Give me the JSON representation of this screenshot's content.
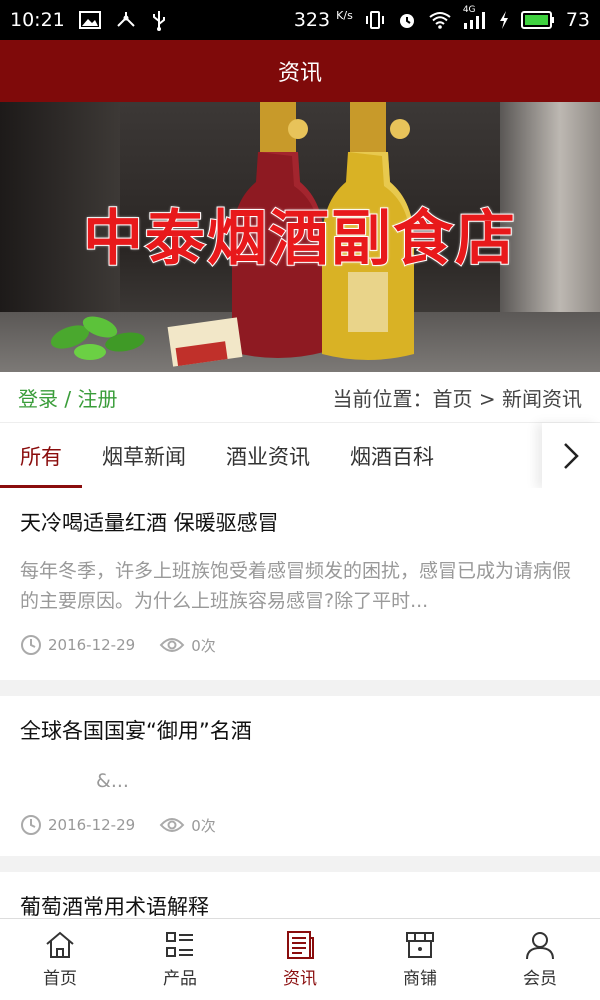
{
  "status_bar": {
    "time": "10:21",
    "speed_value": "323",
    "speed_unit": "K/s",
    "network": "4G",
    "battery": "73",
    "icons": [
      "image-icon",
      "usb-tether-icon",
      "usb-icon",
      "vibrate-icon",
      "alarm-icon",
      "wifi-icon",
      "signal-icon",
      "charging-icon",
      "battery-icon"
    ]
  },
  "appbar": {
    "title": "资讯"
  },
  "banner": {
    "text": "中泰烟酒副食店"
  },
  "locbar": {
    "login": "登录",
    "separator": "/",
    "register": "注册",
    "location_label": "当前位置：",
    "home": "首页",
    "arrow": ">",
    "current": "新闻资讯"
  },
  "tabs": [
    "所有",
    "烟草新闻",
    "酒业资讯",
    "烟酒百科"
  ],
  "news": [
    {
      "title": "天冷喝适量红酒 保暖驱感冒",
      "summary": "每年冬季，许多上班族饱受着感冒频发的困扰，感冒已成为请病假的主要原因。为什么上班族容易感冒?除了平时...",
      "date": "2016-12-29",
      "views": "0次"
    },
    {
      "title": "全球各国国宴“御用”名酒",
      "summary": "&...",
      "date": "2016-12-29",
      "views": "0次"
    },
    {
      "title": "葡萄酒常用术语解释",
      "summary": "",
      "date": "",
      "views": ""
    }
  ],
  "bottom_nav": [
    {
      "label": "首页",
      "icon": "home-icon"
    },
    {
      "label": "产品",
      "icon": "product-list-icon"
    },
    {
      "label": "资讯",
      "icon": "news-icon"
    },
    {
      "label": "商铺",
      "icon": "shop-icon"
    },
    {
      "label": "会员",
      "icon": "member-icon"
    }
  ],
  "colors": {
    "brand": "#7f0a0a",
    "accent": "#8a0d0d",
    "login": "#3a9d3a"
  }
}
